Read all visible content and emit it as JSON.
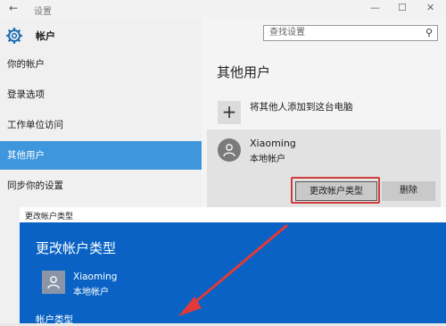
{
  "window": {
    "title": "设置",
    "back": "←",
    "minimize": "—",
    "maximize": "☐",
    "close": "✕"
  },
  "sidebar": {
    "header": "帐户",
    "items": [
      {
        "label": "你的帐户"
      },
      {
        "label": "登录选项"
      },
      {
        "label": "工作单位访问"
      },
      {
        "label": "其他用户"
      },
      {
        "label": "同步你的设置"
      }
    ],
    "selected_index": 3
  },
  "search": {
    "placeholder": "查找设置",
    "icon": "⚲"
  },
  "main": {
    "heading": "其他用户",
    "add_plus": "+",
    "add_label": "将其他人添加到这台电脑",
    "user": {
      "name": "Xiaoming",
      "type": "本地帐户"
    },
    "change_button": "更改帐户类型",
    "delete_button": "删除"
  },
  "dialog": {
    "window_title": "更改帐户类型",
    "heading": "更改帐户类型",
    "user": {
      "name": "Xiaoming",
      "type": "本地帐户"
    },
    "subheading": "帐户类型"
  },
  "colors": {
    "accent": "#3e97dd",
    "dialog_bg": "#0a63c4",
    "highlight": "#d23b3b"
  }
}
